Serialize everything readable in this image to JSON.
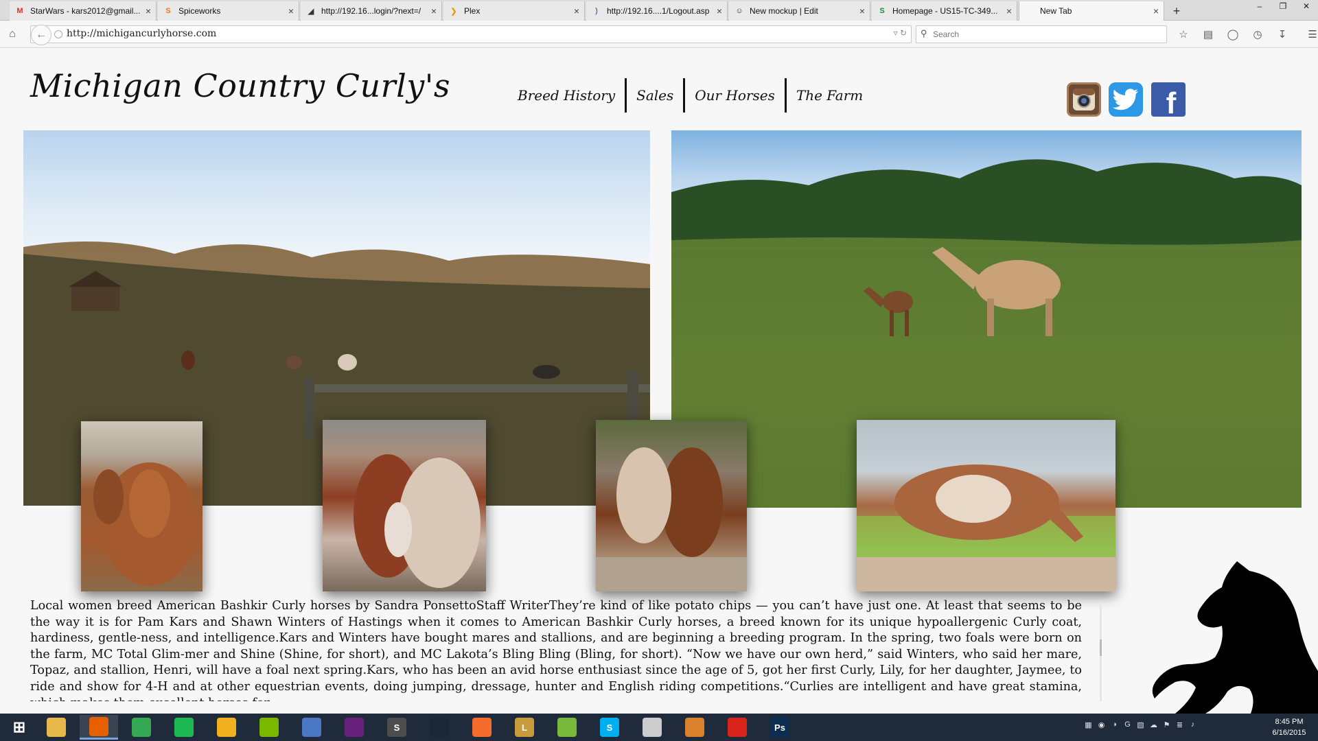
{
  "browser": {
    "tabs": [
      {
        "title": "StarWars - kars2012@gmail...",
        "icon": "gmail-icon",
        "fav": "M",
        "color": "#d93025"
      },
      {
        "title": "Spiceworks",
        "icon": "spiceworks-icon",
        "fav": "S",
        "color": "#f37021"
      },
      {
        "title": "http://192.16...login/?next=/",
        "icon": "sail-icon",
        "fav": "◢",
        "color": "#333333"
      },
      {
        "title": "Plex",
        "icon": "plex-icon",
        "fav": "❯",
        "color": "#e5a00d"
      },
      {
        "title": "http://192.16....1/Logout.asp",
        "icon": "wifi-icon",
        "fav": ")",
        "color": "#4a7ab5"
      },
      {
        "title": "New mockup | Edit",
        "icon": "smiley-icon",
        "fav": "☺",
        "color": "#333333"
      },
      {
        "title": "Homepage - US15-TC-349...",
        "icon": "s-icon",
        "fav": "S",
        "color": "#1a8a3a"
      },
      {
        "title": "New Tab",
        "icon": "blank-icon",
        "fav": "",
        "color": "#999999",
        "active": true
      }
    ],
    "url": "http://michigancurlyhorse.com",
    "search_placeholder": "Search"
  },
  "site": {
    "title": "Michigan Country Curly's",
    "nav": [
      "Breed History",
      "Sales",
      "Our Horses",
      "The Farm"
    ],
    "social": [
      "instagram-icon",
      "twitter-icon",
      "facebook-icon"
    ],
    "facebook_glyph": "f",
    "article": "Local women breed American Bashkir Curly horses by Sandra PonsettoStaff WriterThey’re kind of like potato chips — you can’t have just one. At least that seems to be the way it is for Pam Kars and Shawn Winters of Hastings when it comes to American Bashkir Curly horses, a breed known for its unique hypoallergenic Curly coat, hardiness, gentle-ness, and intelligence.Kars and Winters have bought mares and stallions, and are beginning a breeding program. In the spring, two foals were born on the farm, MC Total Glim-mer and Shine (Shine, for short), and MC Lakota’s Bling Bling (Bling, for short). “Now we have our own herd,” said Winters, who said her mare, Topaz, and stallion, Henri, will have a foal next spring.Kars, who has been an avid horse enthusiast since the age of 5, got her first Curly, Lily, for her daughter, Jaymee, to ride and show for 4-H and at other equestrian events, doing jumping, dressage, hunter and English riding competitions.“Curlies are intelligent and have great stamina, which makes them excellent horses for"
  },
  "taskbar": {
    "apps": [
      {
        "name": "windows-start-icon",
        "label": "",
        "color": "#1f2a3a"
      },
      {
        "name": "file-explorer-icon",
        "label": "",
        "color": "#e8b84a"
      },
      {
        "name": "firefox-icon",
        "label": "",
        "color": "#e66000",
        "active": true
      },
      {
        "name": "chrome-icon",
        "label": "",
        "color": "#34a853"
      },
      {
        "name": "spotify-icon",
        "label": "",
        "color": "#1db954"
      },
      {
        "name": "app-yellow-icon",
        "label": "",
        "color": "#f2b01e"
      },
      {
        "name": "vmware-icon",
        "label": "",
        "color": "#7ab800"
      },
      {
        "name": "installer-icon",
        "label": "",
        "color": "#4a78c2"
      },
      {
        "name": "visual-studio-icon",
        "label": "",
        "color": "#68217a"
      },
      {
        "name": "sublime-icon",
        "label": "S",
        "color": "#4d4d4d"
      },
      {
        "name": "steam-icon",
        "label": "",
        "color": "#1b2838"
      },
      {
        "name": "origin-icon",
        "label": "",
        "color": "#f56c2d"
      },
      {
        "name": "league-icon",
        "label": "L",
        "color": "#c89b3c"
      },
      {
        "name": "utorrent-icon",
        "label": "",
        "color": "#78b83a"
      },
      {
        "name": "skype-icon",
        "label": "S",
        "color": "#00aff0"
      },
      {
        "name": "helmet-icon",
        "label": "",
        "color": "#cccccc"
      },
      {
        "name": "emblem-icon",
        "label": "",
        "color": "#d9822b"
      },
      {
        "name": "acrobat-icon",
        "label": "",
        "color": "#d9241b"
      },
      {
        "name": "photoshop-icon",
        "label": "Ps",
        "color": "#0c2d4f"
      }
    ],
    "time": "8:45 PM",
    "date": "6/16/2015"
  }
}
